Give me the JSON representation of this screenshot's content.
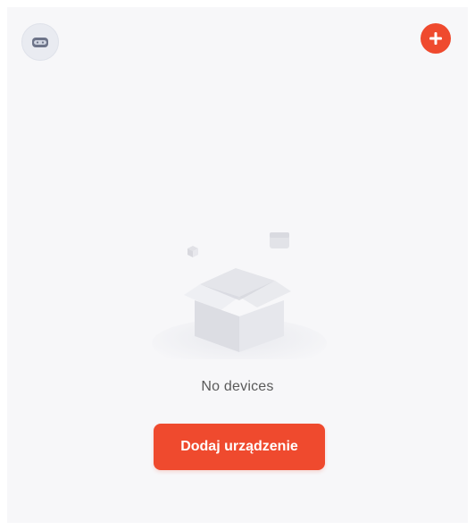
{
  "header": {
    "profile_icon": "robot-face-icon",
    "add_icon": "plus-icon"
  },
  "empty_state": {
    "illustration": "empty-box-icon",
    "message": "No devices",
    "button_label": "Dodaj urządzenie"
  },
  "colors": {
    "accent": "#ef4a2e",
    "background": "#f7f7f9",
    "text_muted": "#5a5a5a"
  }
}
